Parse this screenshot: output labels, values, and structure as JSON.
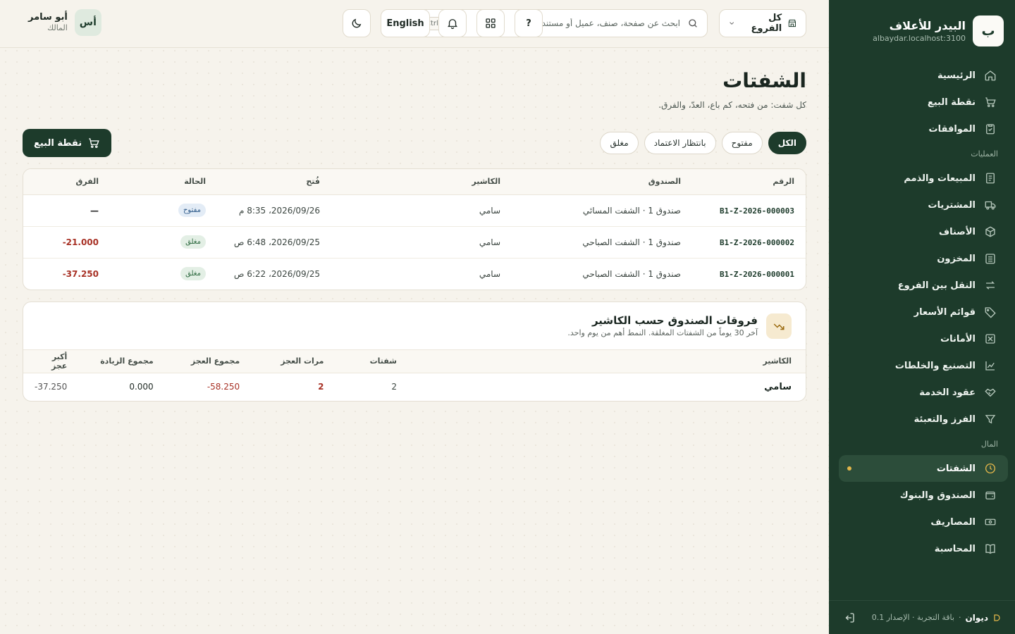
{
  "sidebar": {
    "logo_letter": "ب",
    "brand_name": "البيدر للأعلاف",
    "host": "albaydar.localhost:3100",
    "items_top": [
      {
        "label": "الرئيسية",
        "icon": "home-icon"
      },
      {
        "label": "نقطة البيع",
        "icon": "cart-icon"
      },
      {
        "label": "الموافقات",
        "icon": "clipboard-check-icon"
      }
    ],
    "section_ops": "العمليات",
    "items_ops": [
      {
        "label": "المبيعات والذمم",
        "icon": "receipt-icon"
      },
      {
        "label": "المشتريات",
        "icon": "truck-icon"
      },
      {
        "label": "الأصناف",
        "icon": "box-icon"
      },
      {
        "label": "المخزون",
        "icon": "warehouse-icon"
      },
      {
        "label": "النقل بين الفروع",
        "icon": "transfer-icon"
      },
      {
        "label": "قوائم الأسعار",
        "icon": "tag-icon"
      },
      {
        "label": "الأمانات",
        "icon": "consignment-icon"
      },
      {
        "label": "التصنيع والخلطات",
        "icon": "factory-icon"
      },
      {
        "label": "عقود الخدمة",
        "icon": "handshake-icon"
      },
      {
        "label": "الفرز والتعبئة",
        "icon": "filter-icon"
      }
    ],
    "section_money": "المال",
    "items_money": [
      {
        "label": "الشفتات",
        "icon": "clock-icon",
        "active": true
      },
      {
        "label": "الصندوق والبنوك",
        "icon": "wallet-icon"
      },
      {
        "label": "المصاريف",
        "icon": "banknote-icon"
      },
      {
        "label": "المحاسبة",
        "icon": "book-icon"
      }
    ],
    "footer": {
      "product": "ديوان",
      "plan": "باقة التجربة · الإصدار 0.1"
    }
  },
  "topbar": {
    "branch": "كل الفروع",
    "search_placeholder": "ابحث عن صفحة، صنف، عميل أو مستند...",
    "search_shortcut": "Ctrl K",
    "help": "?",
    "language": "English",
    "user_initials": "أس",
    "user_name": "أبو سامر",
    "user_role": "المالك"
  },
  "page": {
    "title": "الشفتات",
    "subtitle": "كل شفت: من فتحه، كم باع، العدّ، والفرق.",
    "filters": [
      "الكل",
      "مفتوح",
      "بانتظار الاعتماد",
      "مغلق"
    ],
    "active_filter": "الكل",
    "pos_button": "نقطة البيع"
  },
  "shifts_table": {
    "headers": [
      "الرقم",
      "الصندوق",
      "الكاشير",
      "فُتح",
      "الحالة",
      "الفرق"
    ],
    "rows": [
      {
        "number": "B1-Z-2026-000003",
        "drawer": "صندوق 1 · الشفت المسائي",
        "cashier": "سامي",
        "opened": "2026/09/26، 8:35 م",
        "status": "مفتوح",
        "status_type": "open",
        "diff": "—"
      },
      {
        "number": "B1-Z-2026-000002",
        "drawer": "صندوق 1 · الشفت الصباحي",
        "cashier": "سامي",
        "opened": "2026/09/25، 6:48 ص",
        "status": "مغلق",
        "status_type": "closed",
        "diff": "-21.000"
      },
      {
        "number": "B1-Z-2026-000001",
        "drawer": "صندوق 1 · الشفت الصباحي",
        "cashier": "سامي",
        "opened": "2026/09/25، 6:22 ص",
        "status": "مغلق",
        "status_type": "closed",
        "diff": "-37.250"
      }
    ]
  },
  "variance": {
    "title": "فروقات الصندوق حسب الكاشير",
    "subtitle": "آخر 30 يوماً من الشفتات المغلقة. النمط أهم من يوم واحد.",
    "headers": [
      "الكاشير",
      "شفتات",
      "مرات العجز",
      "مجموع العجز",
      "مجموع الزيادة",
      "أكبر عجز"
    ],
    "rows": [
      {
        "cashier": "سامي",
        "shifts": "2",
        "shortage_count": "2",
        "shortage_total": "-58.250",
        "surplus_total": "0.000",
        "max_shortage": "-37.250"
      }
    ]
  }
}
